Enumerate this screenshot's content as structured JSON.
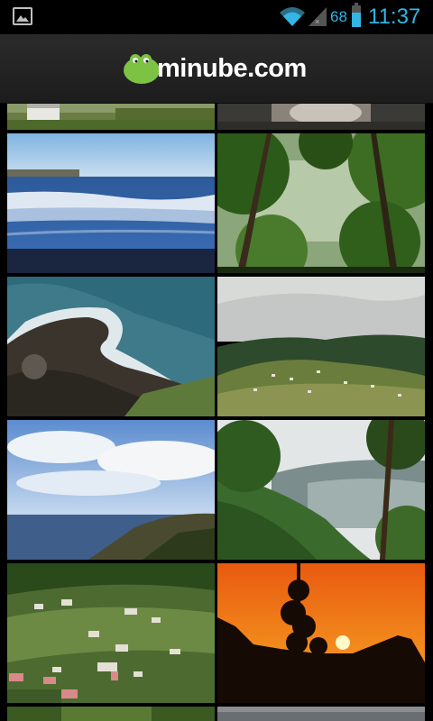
{
  "status_bar": {
    "battery_level_text": "68",
    "battery_level": 0.68,
    "time": "11:37",
    "icons": [
      "gallery-notification-icon",
      "wifi-icon",
      "signal-icon",
      "battery-icon"
    ],
    "accent_color": "#33b5e5"
  },
  "action_bar": {
    "logo_text": "minube.com",
    "logo_icon": "green-blob-logo-icon",
    "brand_color": "#7dc242"
  },
  "photos": [
    {
      "name": "photo-top-left-partial",
      "subject": "grass-and-house"
    },
    {
      "name": "photo-top-right-partial",
      "subject": "rocks"
    },
    {
      "name": "photo-sea-waves",
      "subject": "sea-waves"
    },
    {
      "name": "photo-forest-trees",
      "subject": "forest"
    },
    {
      "name": "photo-coast-rocks-aerial",
      "subject": "coast-aerial"
    },
    {
      "name": "photo-green-valley",
      "subject": "valley"
    },
    {
      "name": "photo-ocean-cliff",
      "subject": "ocean-cliff"
    },
    {
      "name": "photo-pine-mountains",
      "subject": "pine-mountains"
    },
    {
      "name": "photo-village-hillside",
      "subject": "village"
    },
    {
      "name": "photo-sunset-pine",
      "subject": "sunset"
    },
    {
      "name": "photo-bottom-left-partial",
      "subject": "green"
    },
    {
      "name": "photo-bottom-right-partial",
      "subject": "grey"
    }
  ]
}
